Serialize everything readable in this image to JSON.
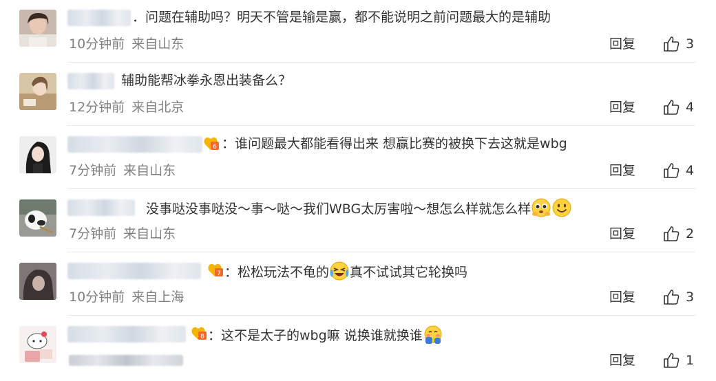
{
  "reply_label": "回复",
  "comments": [
    {
      "text": "．问题在辅助吗？明天不管是输是赢，都不能说明之前问题最大的是辅助",
      "time": "10分钟前",
      "location": "来自山东",
      "likes": "3",
      "has_badge": false
    },
    {
      "text": "辅助能帮冰拳永恩出装备么？",
      "time": "12分钟前",
      "location": "来自北京",
      "likes": "4",
      "has_badge": false
    },
    {
      "text": "：谁问题最大都能看得出来 想赢比赛的被换下去这就是wbg",
      "time": "7分钟前",
      "location": "来自山东",
      "likes": "4",
      "has_badge": true
    },
    {
      "text": "没事哒没事哒没～事～哒～我们WBG太厉害啦～想怎么样就怎么样",
      "time": "7分钟前",
      "location": "来自山东",
      "likes": "2",
      "has_badge": false
    },
    {
      "text_a": "：松松玩法不龟的",
      "text_b": "真不试试其它轮换吗",
      "time": "10分钟前",
      "location": "来自上海",
      "likes": "3",
      "has_badge": true
    },
    {
      "text": "：这不是太子的wbg嘛 说换谁就换谁",
      "likes": "1",
      "has_badge": true
    }
  ],
  "icons": {
    "like": "thumbs-up-outline-icon",
    "badge": "fan-badge-icon",
    "emoji_1": "pleading-face-emoji",
    "emoji_2": "smiling-face-emoji",
    "emoji_3": "laughing-crying-emoji",
    "emoji_4": "shy-face-emoji"
  },
  "colors": {
    "text": "#333333",
    "meta": "#808080",
    "divider": "#e8e8e8",
    "badge": "#f26b2a"
  }
}
